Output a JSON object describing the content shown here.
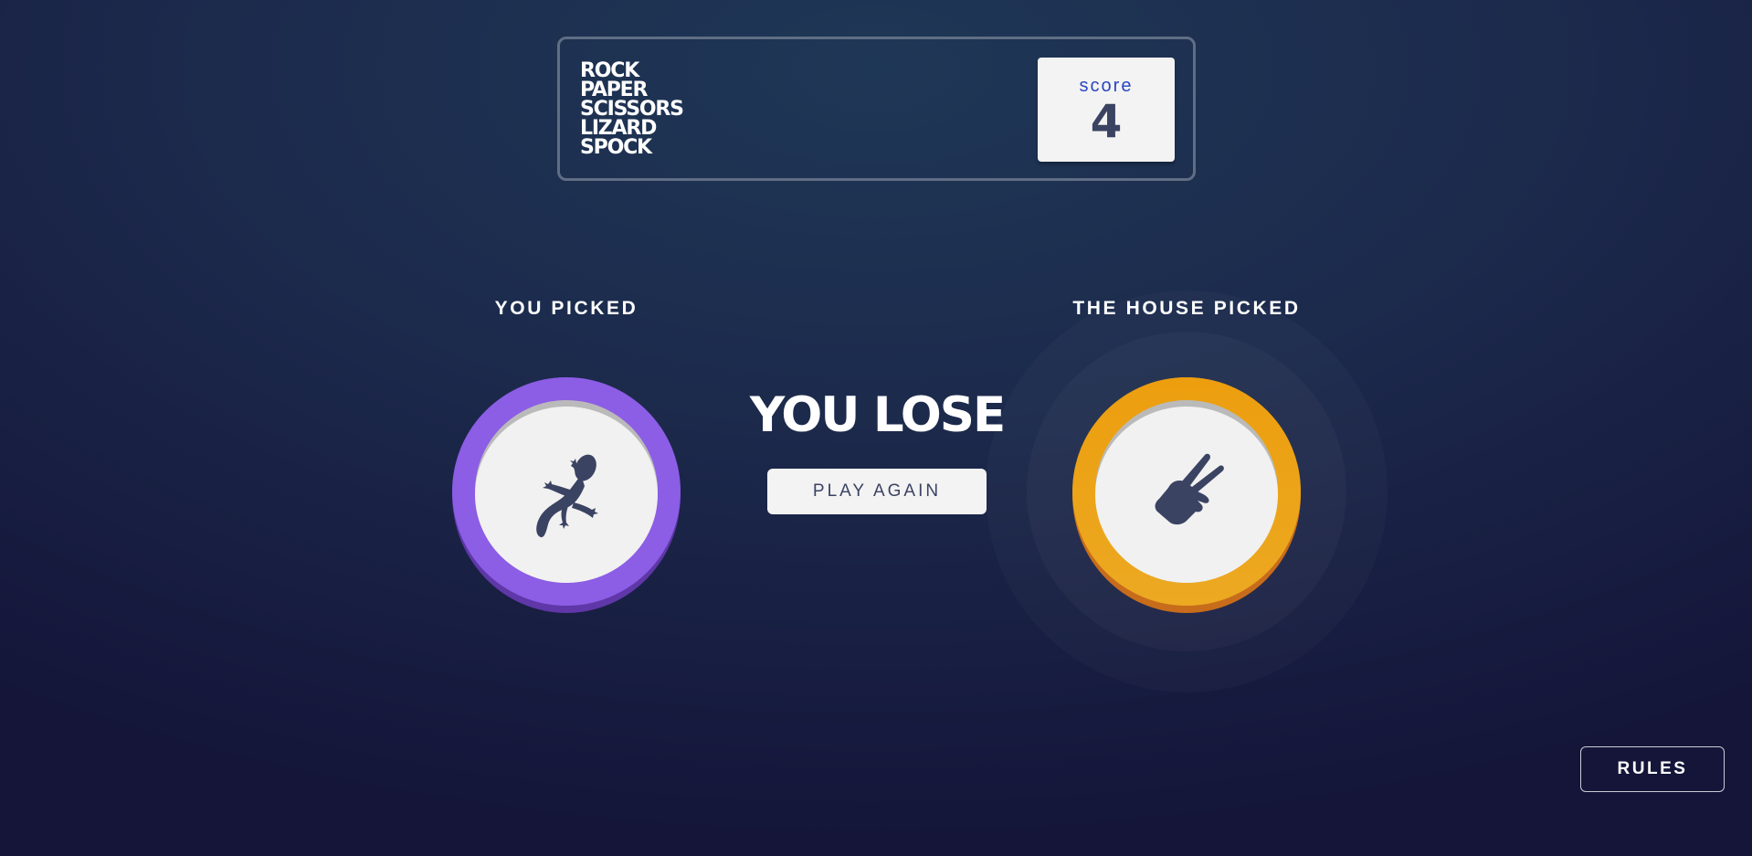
{
  "header": {
    "title_lines": [
      "ROCK",
      "PAPER",
      "SCISSORS",
      "LIZARD",
      "SPOCK"
    ],
    "score_label": "score",
    "score_value": "4"
  },
  "game": {
    "player_label": "YOU PICKED",
    "house_label": "THE HOUSE PICKED",
    "player_pick": "lizard-icon",
    "house_pick": "scissors-icon",
    "result": "YOU LOSE",
    "play_again_label": "PLAY AGAIN"
  },
  "footer": {
    "rules_label": "RULES"
  },
  "colors": {
    "lizard": "#8c5de5",
    "scissors": "#eca922",
    "score_label": "#2a46c0",
    "dark_text": "#3b4363"
  }
}
